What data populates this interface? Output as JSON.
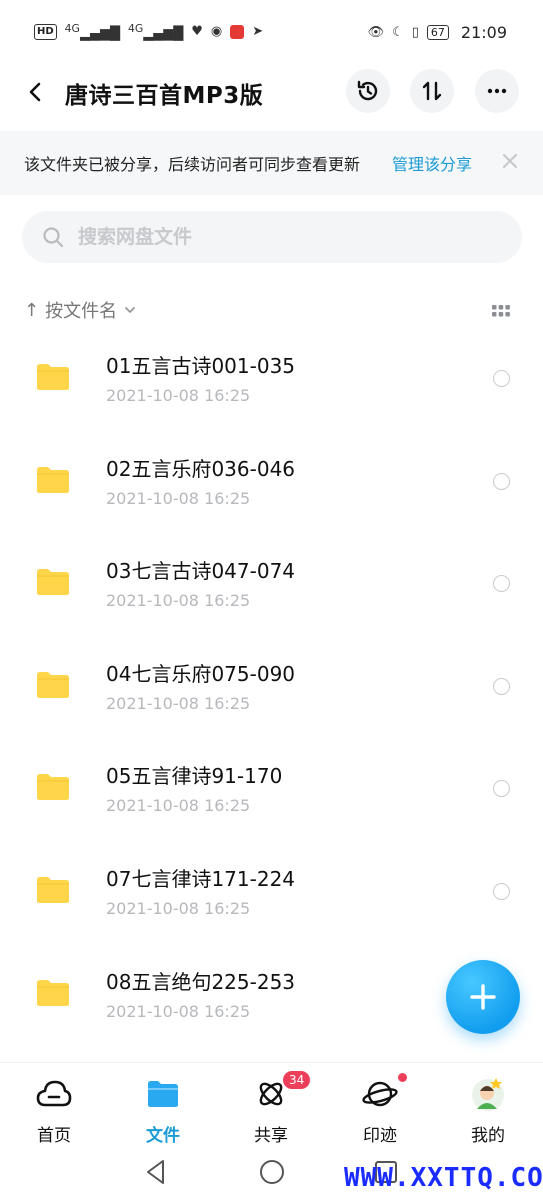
{
  "status_bar": {
    "left_icons": [
      "hd-icon",
      "signal-4g-icon",
      "signal-4g-icon",
      "health-icon",
      "wechat-icon",
      "red-app-icon",
      "navigation-icon"
    ],
    "hd_label": "HD",
    "net1": "4G",
    "net2": "4G",
    "battery": "67",
    "time": "21:09"
  },
  "header": {
    "title": "唐诗三百首MP3版"
  },
  "banner": {
    "text": "该文件夹已被分享，后续访问者可同步查看更新",
    "link": "管理该分享"
  },
  "search": {
    "placeholder": "搜索网盘文件"
  },
  "sort": {
    "arrow": "↑",
    "label": "按文件名"
  },
  "files": [
    {
      "name": "01五言古诗001-035",
      "date": "2021-10-08  16:25"
    },
    {
      "name": "02五言乐府036-046",
      "date": "2021-10-08  16:25"
    },
    {
      "name": "03七言古诗047-074",
      "date": "2021-10-08  16:25"
    },
    {
      "name": "04七言乐府075-090",
      "date": "2021-10-08  16:25"
    },
    {
      "name": "05五言律诗91-170",
      "date": "2021-10-08  16:25"
    },
    {
      "name": "07七言律诗171-224",
      "date": "2021-10-08  16:25"
    },
    {
      "name": "08五言绝句225-253",
      "date": "2021-10-08  16:25"
    }
  ],
  "nav": {
    "tabs": [
      {
        "label": "首页"
      },
      {
        "label": "文件"
      },
      {
        "label": "共享",
        "badge": "34"
      },
      {
        "label": "印迹"
      },
      {
        "label": "我的"
      }
    ]
  },
  "watermark": "WWW.XXTTQ.COM",
  "colors": {
    "accent": "#1a9bd6",
    "folder": "#ffd54a",
    "badge": "#ee3f5a",
    "fab": "#129eef"
  }
}
